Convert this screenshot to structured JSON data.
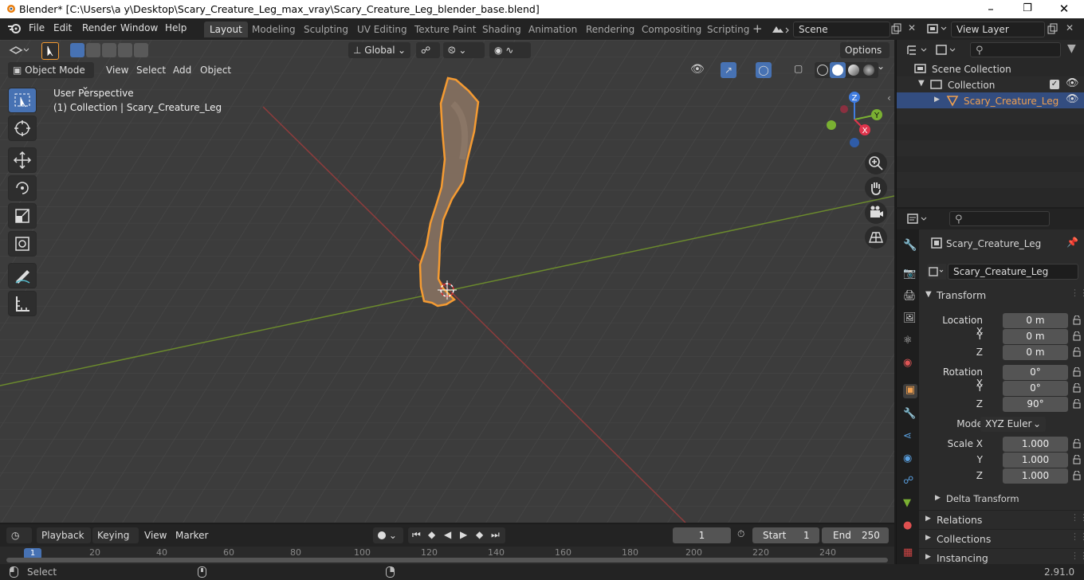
{
  "window": {
    "title": "Blender* [C:\\Users\\a y\\Desktop\\Scary_Creature_Leg_max_vray\\Scary_Creature_Leg_blender_base.blend]"
  },
  "menus": [
    "File",
    "Edit",
    "Render",
    "Window",
    "Help"
  ],
  "workspaces": [
    "Layout",
    "Modeling",
    "Sculpting",
    "UV Editing",
    "Texture Paint",
    "Shading",
    "Animation",
    "Rendering",
    "Compositing",
    "Scripting"
  ],
  "scene": {
    "label": "Scene",
    "view_layer": "View Layer"
  },
  "toolbar": {
    "orientation": "Global",
    "options": "Options"
  },
  "viewport_header": {
    "mode": "Object Mode",
    "menus": [
      "View",
      "Select",
      "Add",
      "Object"
    ]
  },
  "viewport": {
    "perspective": "User Perspective",
    "collection_info": "(1) Collection | Scary_Creature_Leg"
  },
  "gizmo": {
    "z": "Z",
    "y": "Y",
    "x": "X"
  },
  "outliner": {
    "scene_collection": "Scene Collection",
    "collection": "Collection",
    "object": "Scary_Creature_Leg"
  },
  "properties": {
    "object_name": "Scary_Creature_Leg",
    "data_name": "Scary_Creature_Leg",
    "transform_label": "Transform",
    "location": {
      "label_x": "Location X",
      "label_y": "Y",
      "label_z": "Z",
      "x": "0 m",
      "y": "0 m",
      "z": "0 m"
    },
    "rotation": {
      "label_x": "Rotation X",
      "label_y": "Y",
      "label_z": "Z",
      "x": "0°",
      "y": "0°",
      "z": "90°"
    },
    "mode_label": "Mode",
    "mode_value": "XYZ Euler",
    "scale": {
      "label_x": "Scale X",
      "label_y": "Y",
      "label_z": "Z",
      "x": "1.000",
      "y": "1.000",
      "z": "1.000"
    },
    "delta_transform": "Delta Transform",
    "relations": "Relations",
    "collections": "Collections",
    "instancing": "Instancing"
  },
  "timeline": {
    "menus": [
      "Playback",
      "Keying",
      "View",
      "Marker"
    ],
    "current_frame": "1",
    "start_label": "Start",
    "start": "1",
    "end_label": "End",
    "end": "250",
    "ruler": [
      "1",
      "20",
      "40",
      "60",
      "80",
      "100",
      "120",
      "140",
      "160",
      "180",
      "200",
      "220",
      "240"
    ]
  },
  "status": {
    "select": "Select",
    "version": "2.91.0"
  }
}
